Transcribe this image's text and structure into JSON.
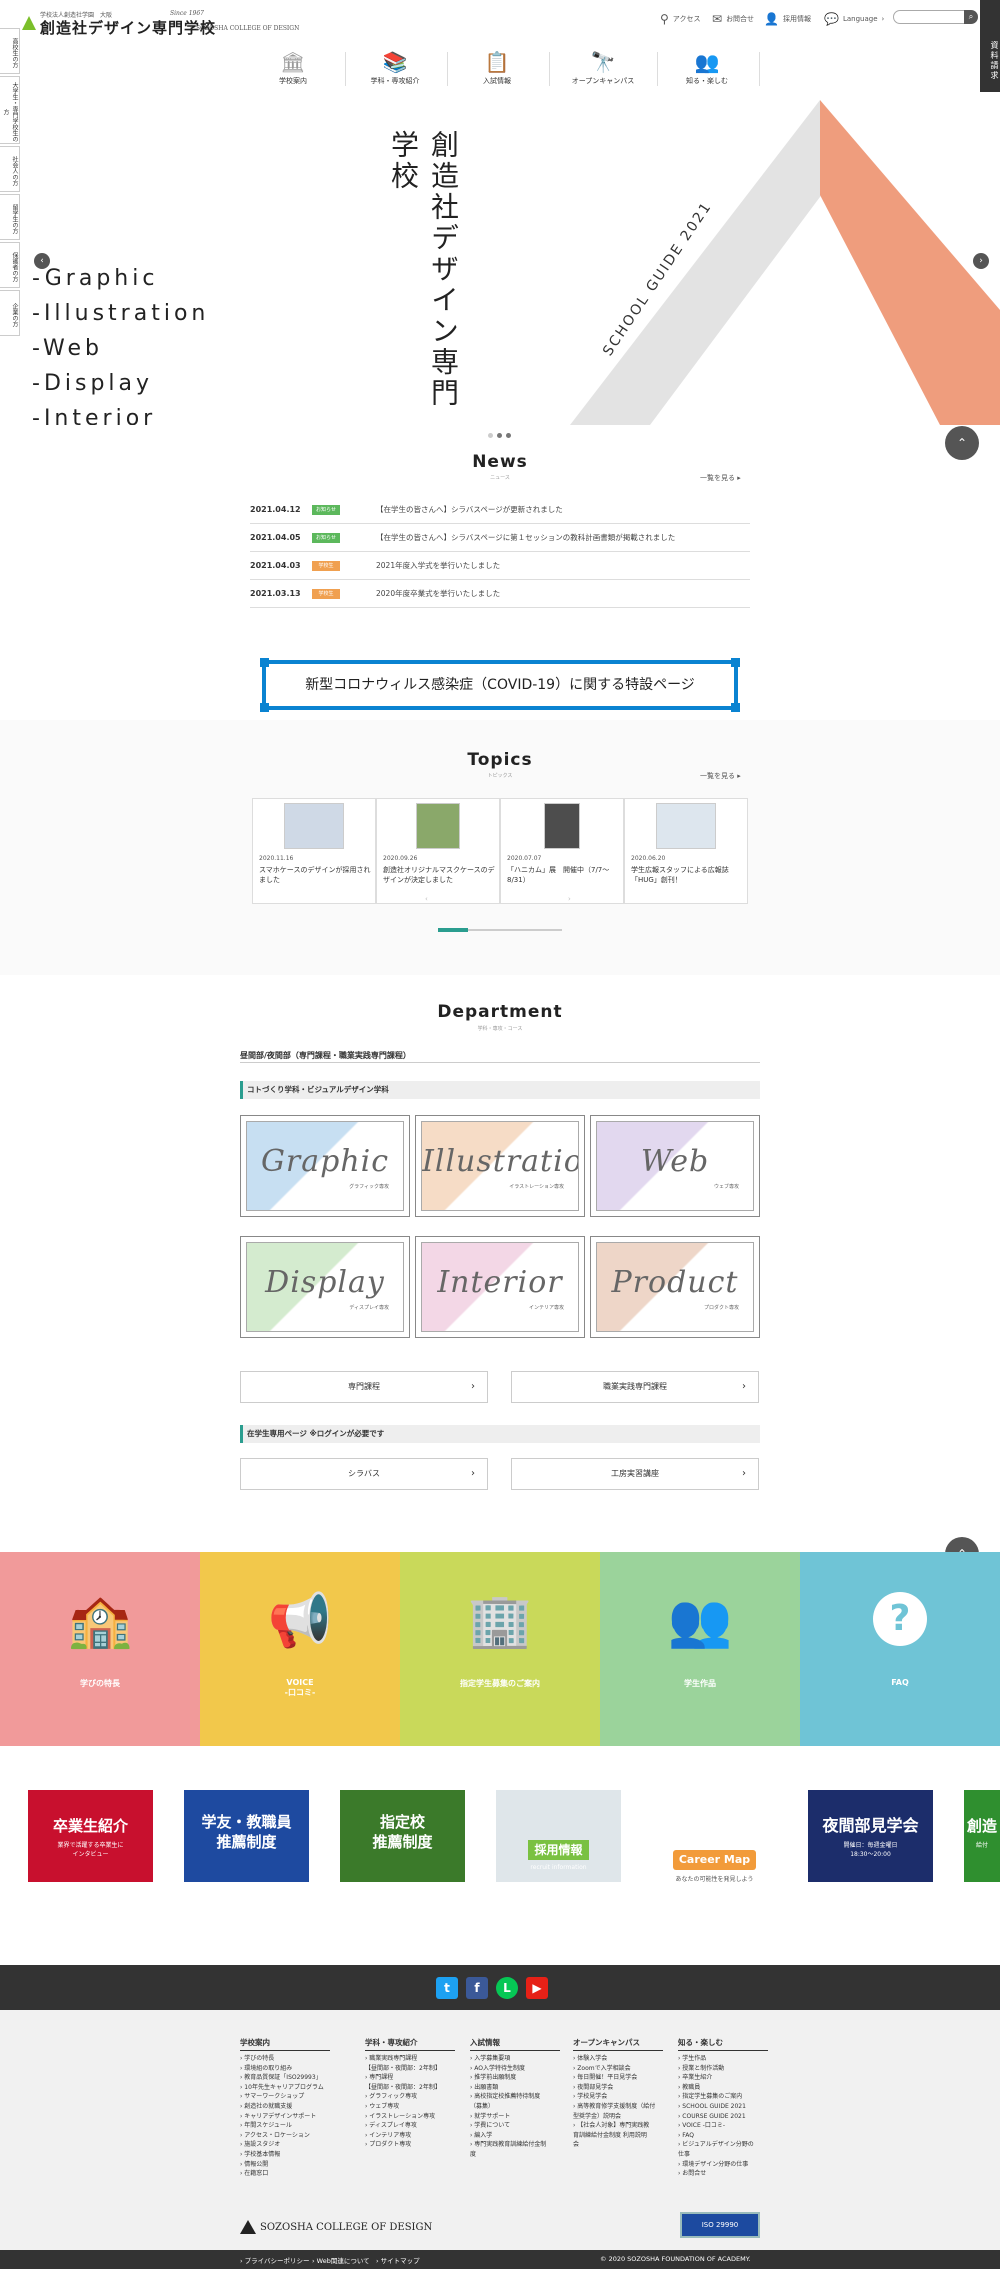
{
  "header": {
    "logo_small": "学校法人創造社学園　大阪",
    "logo_since": "Since 1967",
    "logo_name": "創造社デザイン専門学校",
    "logo_en": "SOZOSHA COLLEGE OF DESIGN",
    "util": [
      "アクセス",
      "お問合せ",
      "採用情報",
      "Language"
    ],
    "side_tab": "資料請求",
    "nav": [
      "学校案内",
      "学科・専攻紹介",
      "入試情報",
      "オープンキャンパス",
      "知る・楽しむ"
    ]
  },
  "left_nav": [
    "高校生の方",
    "大学生・専門学校生の方",
    "社会人の方",
    "留学生の方",
    "保護者の方",
    "企業の方"
  ],
  "hero": {
    "words": [
      "-Graphic",
      "-Illustration",
      "-Web",
      "-Display",
      "-Interior"
    ],
    "vertical_title": "創造社デザイン専門学校",
    "guide_text": "SCHOOL GUIDE 2021"
  },
  "news": {
    "title": "News",
    "subtitle": "ニュース",
    "more": "一覧を見る ▸",
    "items": [
      {
        "date": "2021.04.12",
        "badge": "お知らせ",
        "badge_color": "#5cb85c",
        "text": "【在学生の皆さんへ】シラバスページが更新されました"
      },
      {
        "date": "2021.04.05",
        "badge": "お知らせ",
        "badge_color": "#5cb85c",
        "text": "【在学生の皆さんへ】シラバスページに第１セッションの教科計画書類が掲載されました"
      },
      {
        "date": "2021.04.03",
        "badge": "学校生",
        "badge_color": "#f0a050",
        "text": "2021年度入学式を挙行いたしました"
      },
      {
        "date": "2021.03.13",
        "badge": "学校生",
        "badge_color": "#f0a050",
        "text": "2020年度卒業式を挙行いたしました"
      }
    ]
  },
  "covid_banner": "新型コロナウィルス感染症（COVID-19）に関する特設ページ",
  "topics": {
    "title": "Topics",
    "subtitle": "トピックス",
    "more": "一覧を見る ▸",
    "items": [
      {
        "date": "2020.11.16",
        "title": "スマホケースのデザインが採用されました"
      },
      {
        "date": "2020.09.26",
        "title": "創造社オリジナルマスクケースのデザインが決定しました"
      },
      {
        "date": "2020.07.07",
        "title": "「ハニカム」展　開催中（7/7〜8/31）"
      },
      {
        "date": "2020.06.20",
        "title": "学生広報スタッフによる広報誌「HUG」創刊！"
      }
    ]
  },
  "department": {
    "title": "Department",
    "subtitle": "学科・専攻・コース",
    "heading": "昼間部/夜間部（専門課程・職業実践専門課程）",
    "bar": "コトづくり学科・ビジュアルデザイン学科",
    "courses": [
      {
        "script": "Graphic",
        "jp": "グラフィック専攻",
        "color": "#c7dff2"
      },
      {
        "script": "Illustration",
        "jp": "イラストレーション専攻",
        "color": "#f6dcc6"
      },
      {
        "script": "Web",
        "jp": "ウェブ専攻",
        "color": "#e2d8ef"
      },
      {
        "script": "Display",
        "jp": "ディスプレイ専攻",
        "color": "#d4ebcf"
      },
      {
        "script": "Interior",
        "jp": "インテリア専攻",
        "color": "#f3d7e6"
      },
      {
        "script": "Product",
        "jp": "プロダクト専攻",
        "color": "#eed6c8"
      }
    ],
    "buttons": [
      "専門課程",
      "職業実践専門課程"
    ],
    "student_bar": "在学生専用ページ ※ログインが必要です",
    "student_buttons": [
      "シラバス",
      "工房実習講座"
    ]
  },
  "bands": [
    {
      "label": "学びの特長",
      "color": "#f19a9a",
      "icon": "school-icon"
    },
    {
      "label": "VOICE\n-口コミ-",
      "color": "#f2c84b",
      "icon": "megaphone-icon"
    },
    {
      "label": "指定学生募集のご案内",
      "color": "#c9d95a",
      "icon": "building-icon"
    },
    {
      "label": "学生作品",
      "color": "#9bd39b",
      "icon": "people-icon"
    },
    {
      "label": "FAQ",
      "color": "#6fc4d6",
      "icon": "question-icon"
    }
  ],
  "banners": [
    {
      "title": "卒業生紹介",
      "sub": "業界で活躍する卒業生に\nインタビュー",
      "color": "#c8102e"
    },
    {
      "title": "学友・教職員\n推薦制度",
      "sub": "",
      "color": "#1e4aa0"
    },
    {
      "title": "指定校\n推薦制度",
      "sub": "",
      "color": "#3b7a2a"
    },
    {
      "title": "採用情報",
      "sub": "recruit information",
      "color": "#dfe6ea"
    },
    {
      "title": "Career Map",
      "sub": "あなたの可能性を発見しよう",
      "color": "#ffffff"
    },
    {
      "title": "夜間部見学会",
      "sub": "開催日：毎週金曜日\n18:30〜20:00",
      "color": "#1c2d6b"
    },
    {
      "title": "創造",
      "sub": "給付",
      "color": "#2f8f2f"
    }
  ],
  "sns": [
    {
      "name": "twitter-icon",
      "glyph": "t",
      "color": "#1da1f2"
    },
    {
      "name": "facebook-icon",
      "glyph": "f",
      "color": "#3b5998"
    },
    {
      "name": "line-icon",
      "glyph": "L",
      "color": "#06c755"
    },
    {
      "name": "youtube-icon",
      "glyph": "▶",
      "color": "#e62117"
    }
  ],
  "footer": {
    "columns": [
      {
        "head": "学校案内",
        "items": [
          "› 学びの特長",
          "› 環境組の取り組み",
          "› 教育品質保証「ISO29993」",
          "› 10年先生キャリアプログラム",
          "› サマーワークショップ",
          "› 創造社の就職支援",
          "› キャリアデザインサポート",
          "› 年間スケジュール",
          "› アクセス・ロケーション",
          "› 施設スタジオ",
          "› 学校基本情報",
          "› 情報公開",
          "› 在籍窓口"
        ]
      },
      {
        "head": "学科・専攻紹介",
        "items": [
          "› 職業実践専門課程",
          "【昼間部・夜間部：2年制】",
          "› 専門課程",
          "【昼間部・夜間部：2年制】",
          "› グラフィック専攻",
          "› ウェブ専攻",
          "› イラストレーション専攻",
          "› ディスプレイ専攻",
          "› インテリア専攻",
          "› プロダクト専攻"
        ]
      },
      {
        "head": "入試情報",
        "items": [
          "› 入学募集要項",
          "› AO入学特待生制度",
          "› 推学前出願制度",
          "› 出願書類",
          "› 高校指定校推薦特待制度",
          "（募集）",
          "› 就学サポート",
          "› 学費について",
          "› 編入学",
          "› 専門実践教育訓練給付金制",
          "度"
        ]
      },
      {
        "head": "オープンキャンパス",
        "items": [
          "› 体験入学会",
          "› Zoomで入学相談会",
          "› 毎日開催！平日見学会",
          "› 夜間部見学会",
          "› 学校見学会",
          "› 高等教育修学支援制度（給付",
          "型奨学金）説明会",
          "› 【社会人対象】専門実践教",
          "育訓練給付金制度 利用説明",
          "会"
        ]
      },
      {
        "head": "知る・楽しむ",
        "items": [
          "› 学生作品",
          "› 授業と制作活動",
          "› 卒業生紹介",
          "› 教職員",
          "› 指定学生募集のご案内",
          "› SCHOOL GUIDE 2021",
          "› COURSE GUIDE 2021",
          "› VOICE -口コミ-",
          "› FAQ",
          "› ビジュアルデザイン分野の",
          "仕事",
          "› 環境デザイン分野の仕事",
          "› お問合せ"
        ]
      }
    ],
    "logo": "SOZOSHA COLLEGE OF DESIGN",
    "iso": "ISO 29990",
    "bottom_links": [
      "› プライバシーポリシー",
      "› Web関連について",
      "› サイトマップ"
    ],
    "copyright": "© 2020 SOZOSHA FOUNDATION OF ACADEMY."
  }
}
